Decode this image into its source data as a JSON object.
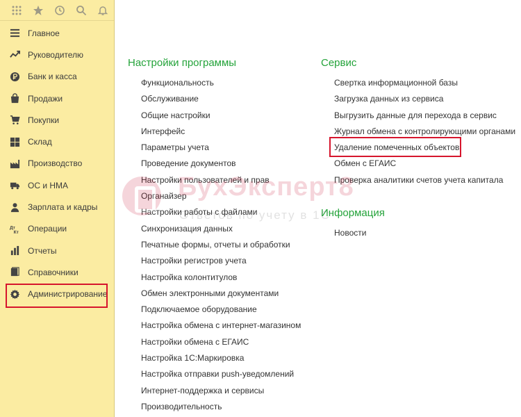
{
  "toolbar": {
    "icons": [
      "apps-grid-icon",
      "favorites-star-icon",
      "history-icon",
      "search-icon",
      "notifications-bell-icon"
    ]
  },
  "sidebar": {
    "items": [
      {
        "label": "Главное",
        "icon": "menu-lines-icon"
      },
      {
        "label": "Руководителю",
        "icon": "trend-chart-icon"
      },
      {
        "label": "Банк и касса",
        "icon": "ruble-coin-icon"
      },
      {
        "label": "Продажи",
        "icon": "shopping-bag-icon"
      },
      {
        "label": "Покупки",
        "icon": "cart-icon"
      },
      {
        "label": "Склад",
        "icon": "warehouse-grid-icon"
      },
      {
        "label": "Производство",
        "icon": "factory-icon"
      },
      {
        "label": "ОС и НМА",
        "icon": "truck-icon"
      },
      {
        "label": "Зарплата и кадры",
        "icon": "person-icon"
      },
      {
        "label": "Операции",
        "icon": "debit-credit-icon"
      },
      {
        "label": "Отчеты",
        "icon": "report-chart-icon"
      },
      {
        "label": "Справочники",
        "icon": "books-icon"
      },
      {
        "label": "Администрирование",
        "icon": "gear-icon"
      }
    ],
    "highlighted_item": "Администрирование"
  },
  "main": {
    "settings": {
      "title": "Настройки программы",
      "links": [
        "Функциональность",
        "Обслуживание",
        "Общие настройки",
        "Интерфейс",
        "Параметры учета",
        "Проведение документов",
        "Настройки пользователей и прав",
        "Органайзер",
        "Настройки работы с файлами",
        "Синхронизация данных",
        "Печатные формы, отчеты и обработки",
        "Настройки регистров учета",
        "Настройка колонтитулов",
        "Обмен электронными документами",
        "Подключаемое оборудование",
        "Настройка обмена с интернет-магазином",
        "Настройки обмена с ЕГАИС",
        "Настройка 1С:Маркировка",
        "Настройка отправки push-уведомлений",
        "Интернет-поддержка и сервисы",
        "Производительность"
      ]
    },
    "service": {
      "title": "Сервис",
      "links": [
        "Свертка информационной базы",
        "Загрузка данных из сервиса",
        "Выгрузить данные для перехода в сервис",
        "Журнал обмена с контролирующими органами",
        "Удаление помеченных объектов",
        "Обмен с ЕГАИС",
        "Проверка аналитики счетов учета капитала"
      ],
      "highlighted_link": "Удаление помеченных объектов"
    },
    "info": {
      "title": "Информация",
      "links": [
        "Новости"
      ]
    }
  },
  "watermark": {
    "title": "БухЭксперт8",
    "subtitle": "Ответов по учету в 1С"
  },
  "colors": {
    "sidebar_bg": "#fbeca2",
    "section_title": "#24a33a",
    "highlight_border": "#d6152d",
    "text": "#333333"
  }
}
